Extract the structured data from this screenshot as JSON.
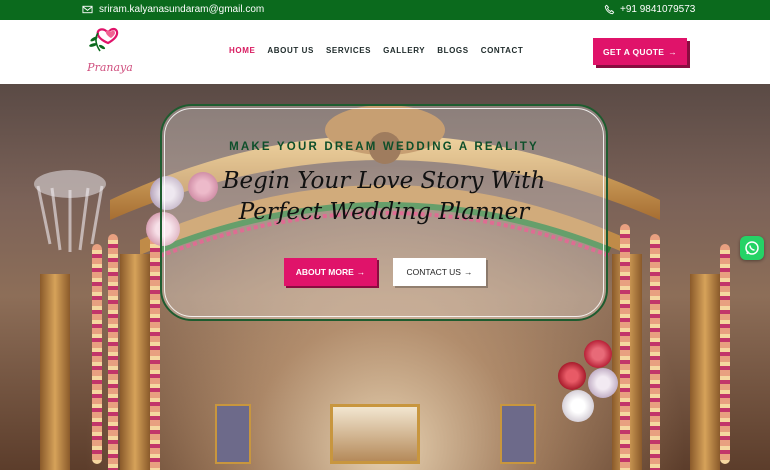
{
  "topbar": {
    "email": "sriram.kalyanasundaram@gmail.com",
    "phone": "+91 9841079573",
    "email_icon": "envelope-icon",
    "phone_icon": "phone-icon",
    "background_color": "#0b6a1d"
  },
  "header": {
    "logo_text": "Pranaya",
    "logo_icon": "hearts-leaf-logo",
    "nav": [
      {
        "label": "HOME",
        "active": true
      },
      {
        "label": "ABOUT US",
        "active": false
      },
      {
        "label": "SERVICES",
        "active": false
      },
      {
        "label": "GALLERY",
        "active": false
      },
      {
        "label": "BLOGS",
        "active": false
      },
      {
        "label": "CONTACT",
        "active": false
      }
    ],
    "cta_label": "GET A QUOTE",
    "cta_icon": "arrow-right-icon"
  },
  "hero": {
    "tagline": "MAKE YOUR DREAM WEDDING A REALITY",
    "headline_line1": "Begin Your Love Story With",
    "headline_line2": "Perfect Wedding Planner",
    "primary_button": "ABOUT MORE",
    "secondary_button": "CONTACT US"
  },
  "floating": {
    "whatsapp_icon": "whatsapp-icon"
  },
  "colors": {
    "accent": "#e0136a",
    "brand_green": "#0b6a1d",
    "headline_green": "#0e4f2a"
  }
}
